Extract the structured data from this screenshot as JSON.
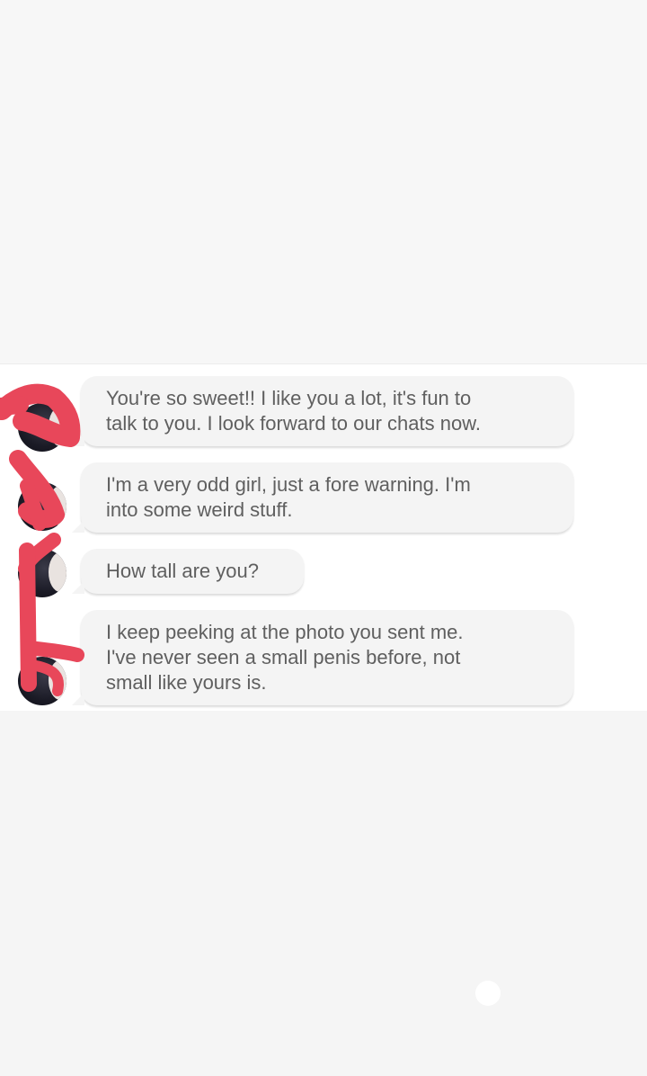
{
  "messages": [
    {
      "text": "You're so sweet!! I like you a lot, it's fun to\ntalk to you. I look forward to our chats now."
    },
    {
      "text": "I'm a very odd girl, just a fore warning. I'm\ninto some weird stuff."
    },
    {
      "text": "How tall are you?"
    },
    {
      "text": "I keep peeking at the photo you sent me.\nI've never seen a small penis before, not\nsmall like yours is."
    }
  ],
  "colors": {
    "bubble": "#f4f4f4",
    "text": "#5f5f5f",
    "redaction": "#e8475a",
    "background": "#f5f5f5"
  },
  "icons": {
    "avatar": "profile-photo",
    "nav": "home-dot"
  }
}
